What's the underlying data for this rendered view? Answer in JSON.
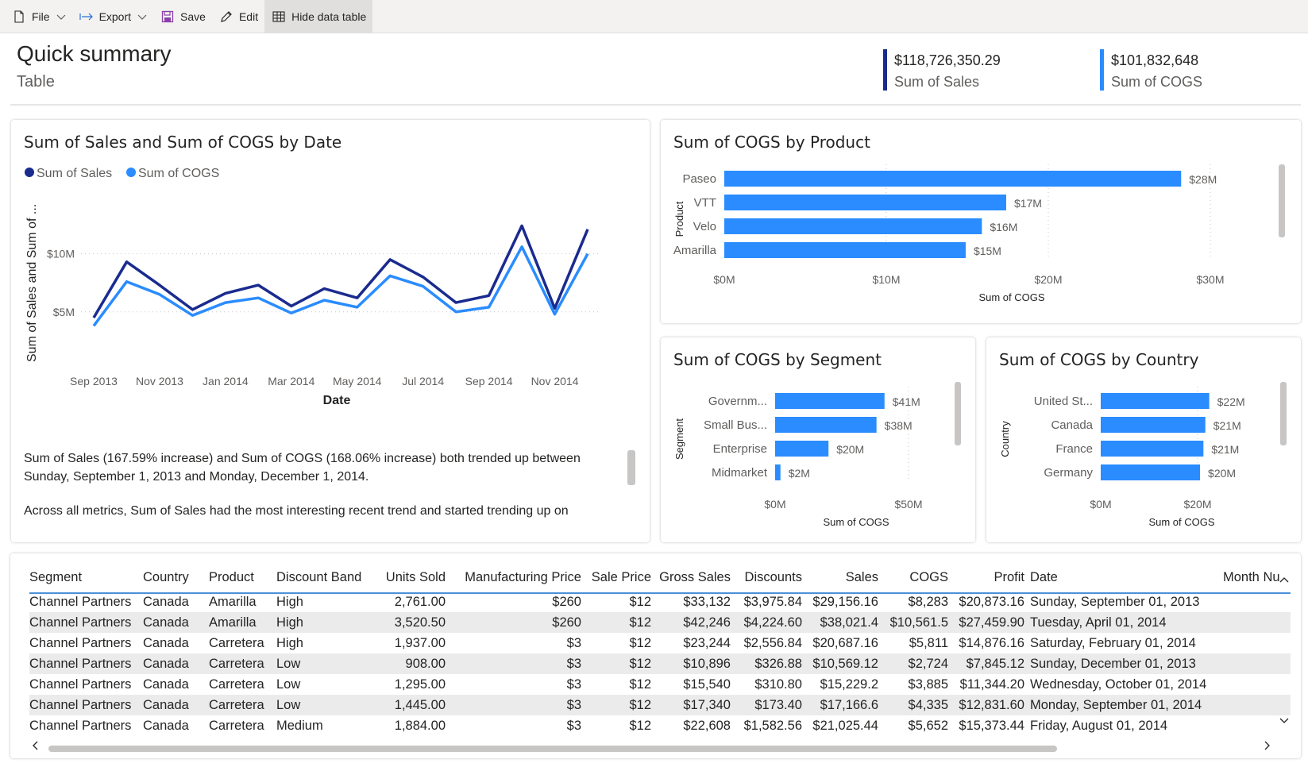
{
  "toolbar": {
    "file": "File",
    "export": "Export",
    "save": "Save",
    "edit": "Edit",
    "hide_table": "Hide data table"
  },
  "header": {
    "title": "Quick summary",
    "subtitle": "Table",
    "kpis": [
      {
        "value": "$118,726,350.29",
        "label": "Sum of Sales",
        "color": "#1a2b8f"
      },
      {
        "value": "$101,832,648",
        "label": "Sum of COGS",
        "color": "#2a8cff"
      }
    ]
  },
  "colors": {
    "sales": "#1a2b8f",
    "cogs": "#2a8cff"
  },
  "line_card": {
    "title": "Sum of Sales and Sum of COGS by Date",
    "narrative": [
      "Sum of   Sales (167.59% increase) and Sum of  COGS (168.06% increase) both trended up between Sunday, September 1, 2013 and Monday, December 1, 2014.",
      "Across all metrics, Sum of   Sales had the most interesting recent trend and started trending up on"
    ]
  },
  "chart_data": [
    {
      "type": "line",
      "title": "Sum of Sales and Sum of COGS by Date",
      "xlabel": "Date",
      "ylabel": "Sum of Sales and Sum of ...",
      "x": [
        "Sep 2013",
        "Oct 2013",
        "Nov 2013",
        "Dec 2013",
        "Jan 2014",
        "Feb 2014",
        "Mar 2014",
        "Apr 2014",
        "May 2014",
        "Jun 2014",
        "Jul 2014",
        "Aug 2014",
        "Sep 2014",
        "Oct 2014",
        "Nov 2014",
        "Dec 2014"
      ],
      "x_tick_labels": [
        "Sep 2013",
        "Nov 2013",
        "Jan 2014",
        "Mar 2014",
        "May 2014",
        "Jul 2014",
        "Sep 2014",
        "Nov 2014"
      ],
      "y_ticks": [
        {
          "value": 5,
          "label": "$5M"
        },
        {
          "value": 10,
          "label": "$10M"
        }
      ],
      "ylim": [
        0,
        14
      ],
      "legend": "top-left",
      "series": [
        {
          "name": "Sum of   Sales",
          "color": "#1a2b8f",
          "values": [
            4.5,
            9.3,
            7.3,
            5.2,
            6.6,
            7.3,
            5.5,
            7.0,
            6.2,
            9.5,
            8.0,
            5.8,
            6.4,
            12.4,
            5.3,
            12.1
          ]
        },
        {
          "name": "Sum of  COGS",
          "color": "#2a8cff",
          "values": [
            3.8,
            7.6,
            6.5,
            4.7,
            5.8,
            6.2,
            4.9,
            6.0,
            5.4,
            8.1,
            7.2,
            5.0,
            5.4,
            10.6,
            4.8,
            10.0
          ]
        }
      ]
    },
    {
      "type": "bar",
      "orientation": "horizontal",
      "title": "Sum of COGS by Product",
      "ylabel": "Product",
      "xlabel": "Sum of COGS",
      "categories": [
        "Paseo",
        "VTT",
        "Velo",
        "Amarilla"
      ],
      "values": [
        28.2,
        17.4,
        15.9,
        14.9
      ],
      "data_labels": [
        "$28M",
        "$17M",
        "$16M",
        "$15M"
      ],
      "x_ticks": [
        {
          "value": 0,
          "label": "$0M"
        },
        {
          "value": 10,
          "label": "$10M"
        },
        {
          "value": 20,
          "label": "$20M"
        },
        {
          "value": 30,
          "label": "$30M"
        }
      ],
      "xlim": [
        0,
        30
      ]
    },
    {
      "type": "bar",
      "orientation": "horizontal",
      "title": "Sum of COGS by Segment",
      "ylabel": "Segment",
      "xlabel": "Sum of COGS",
      "categories": [
        "Governm...",
        "Small Bus...",
        "Enterprise",
        "Midmarket"
      ],
      "values": [
        41,
        38,
        20,
        2
      ],
      "data_labels": [
        "$41M",
        "$38M",
        "$20M",
        "$2M"
      ],
      "x_ticks": [
        {
          "value": 0,
          "label": "$0M"
        },
        {
          "value": 50,
          "label": "$50M"
        }
      ],
      "xlim": [
        0,
        50
      ]
    },
    {
      "type": "bar",
      "orientation": "horizontal",
      "title": "Sum of COGS by Country",
      "ylabel": "Country",
      "xlabel": "Sum of COGS",
      "categories": [
        "United St...",
        "Canada",
        "France",
        "Germany"
      ],
      "values": [
        22.4,
        21.6,
        21.2,
        20.5
      ],
      "data_labels": [
        "$22M",
        "$21M",
        "$21M",
        "$20M"
      ],
      "x_ticks": [
        {
          "value": 0,
          "label": "$0M"
        },
        {
          "value": 20,
          "label": "$20M"
        }
      ],
      "xlim": [
        0,
        20
      ]
    }
  ],
  "table": {
    "columns": [
      "Segment",
      "Country",
      "Product",
      "Discount Band",
      "Units Sold",
      "Manufacturing Price",
      "Sale Price",
      "Gross Sales",
      "Discounts",
      "Sales",
      "COGS",
      "Profit",
      "Date",
      "Month Nu"
    ],
    "rows": [
      [
        "Channel Partners",
        "Canada",
        "Amarilla",
        "High",
        "2,761.00",
        "$260",
        "$12",
        "$33,132",
        "$3,975.84",
        "$29,156.16",
        "$8,283",
        "$20,873.16",
        "Sunday, September 01, 2013",
        ""
      ],
      [
        "Channel Partners",
        "Canada",
        "Amarilla",
        "High",
        "3,520.50",
        "$260",
        "$12",
        "$42,246",
        "$4,224.60",
        "$38,021.4",
        "$10,561.5",
        "$27,459.90",
        "Tuesday, April 01, 2014",
        ""
      ],
      [
        "Channel Partners",
        "Canada",
        "Carretera",
        "High",
        "1,937.00",
        "$3",
        "$12",
        "$23,244",
        "$2,556.84",
        "$20,687.16",
        "$5,811",
        "$14,876.16",
        "Saturday, February 01, 2014",
        ""
      ],
      [
        "Channel Partners",
        "Canada",
        "Carretera",
        "Low",
        "908.00",
        "$3",
        "$12",
        "$10,896",
        "$326.88",
        "$10,569.12",
        "$2,724",
        "$7,845.12",
        "Sunday, December 01, 2013",
        ""
      ],
      [
        "Channel Partners",
        "Canada",
        "Carretera",
        "Low",
        "1,295.00",
        "$3",
        "$12",
        "$15,540",
        "$310.80",
        "$15,229.2",
        "$3,885",
        "$11,344.20",
        "Wednesday, October 01, 2014",
        ""
      ],
      [
        "Channel Partners",
        "Canada",
        "Carretera",
        "Low",
        "1,445.00",
        "$3",
        "$12",
        "$17,340",
        "$173.40",
        "$17,166.6",
        "$4,335",
        "$12,831.60",
        "Monday, September 01, 2014",
        ""
      ],
      [
        "Channel Partners",
        "Canada",
        "Carretera",
        "Medium",
        "1,884.00",
        "$3",
        "$12",
        "$22,608",
        "$1,582.56",
        "$21,025.44",
        "$5,652",
        "$15,373.44",
        "Friday, August 01, 2014",
        ""
      ]
    ]
  }
}
